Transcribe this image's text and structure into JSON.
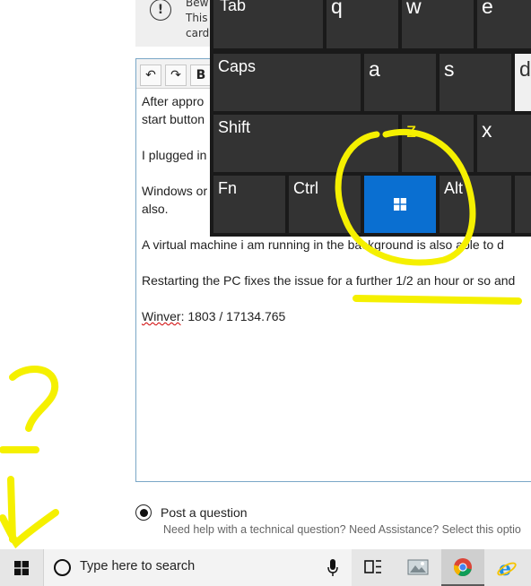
{
  "warning": {
    "line1": "Bew",
    "line2": "This",
    "line3": "card",
    "icon": "exclamation-circle-icon"
  },
  "editor": {
    "toolbar": {
      "undo_icon": "undo-icon",
      "redo_icon": "redo-icon",
      "bold_label": "B"
    },
    "lines": [
      "After appro",
      "start button",
      "I plugged in",
      "Windows or",
      "also.",
      "A virtual machine i am running in the background is also able to d",
      "Restarting the PC fixes the issue for a further 1/2 an hour or so and"
    ],
    "winver_label": "Winver",
    "winver_value": ": 1803 / 17134.765"
  },
  "keyboard": {
    "row1": [
      "Tab",
      "q",
      "w",
      "e"
    ],
    "row2": [
      "Caps",
      "a",
      "s",
      "d"
    ],
    "row3": [
      "Shift",
      "z",
      "x"
    ],
    "row4": [
      "Fn",
      "Ctrl",
      "Alt"
    ],
    "win_key_icon": "windows-logo-icon"
  },
  "post": {
    "label": "Post a question",
    "sublabel": "Need help with a technical question? Need Assistance? Select this optio"
  },
  "taskbar": {
    "search_placeholder": "Type here to search",
    "icons": [
      "windows-start-icon",
      "search-circle-icon",
      "microphone-icon",
      "task-view-icon",
      "photos-app-icon",
      "chrome-icon",
      "internet-explorer-icon"
    ]
  },
  "annotations": {
    "color": "#f5f000",
    "question_mark": "?"
  }
}
